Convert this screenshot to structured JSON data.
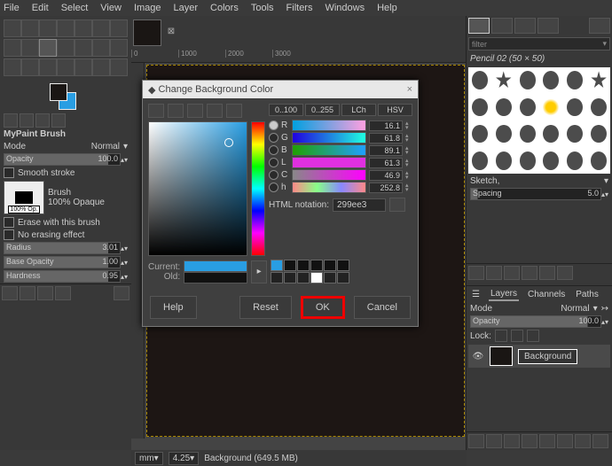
{
  "menu": [
    "File",
    "Edit",
    "Select",
    "View",
    "Image",
    "Layer",
    "Colors",
    "Tools",
    "Filters",
    "Windows",
    "Help"
  ],
  "toolbox": {
    "section_title": "MyPaint Brush",
    "mode_label": "Mode",
    "mode_value": "Normal",
    "opacity_label": "Opacity",
    "opacity_value": "100.0",
    "smooth_stroke": "Smooth stroke",
    "brush_label": "Brush",
    "brush_badge": "100% Op.",
    "brush_name": "100% Opaque",
    "erase_label": "Erase with this brush",
    "no_erase_label": "No erasing effect",
    "radius_label": "Radius",
    "radius_value": "3.01",
    "base_opacity_label": "Base Opacity",
    "base_opacity_value": "1.00",
    "hardness_label": "Hardness",
    "hardness_value": "0.95"
  },
  "ruler": {
    "0": "0",
    "1": "1000",
    "2": "2000",
    "3": "3000"
  },
  "statusbar": {
    "units": "mm",
    "zoom": "4.25",
    "layer": "Background (649.5 MB)"
  },
  "brushes": {
    "filter": "filter",
    "current": "Pencil 02 (50 × 50)",
    "category": "Sketch,",
    "spacing_label": "Spacing",
    "spacing_value": "5.0"
  },
  "layers": {
    "tabs": {
      "layers": "Layers",
      "channels": "Channels",
      "paths": "Paths"
    },
    "mode_label": "Mode",
    "mode_value": "Normal",
    "opacity_label": "Opacity",
    "opacity_value": "100.0",
    "lock_label": "Lock:",
    "layer_name": "Background"
  },
  "dialog": {
    "title": "Change Background Color",
    "range_a": "0..100",
    "range_b": "0..255",
    "model_a": "LCh",
    "model_b": "HSV",
    "channels": {
      "R": {
        "label": "R",
        "value": "16.1"
      },
      "G": {
        "label": "G",
        "value": "61.8"
      },
      "B": {
        "label": "B",
        "value": "89.1"
      },
      "L": {
        "label": "L",
        "value": "61.3"
      },
      "C": {
        "label": "C",
        "value": "46.9"
      },
      "h": {
        "label": "h",
        "value": "252.8"
      }
    },
    "html_label": "HTML notation:",
    "html_value": "299ee3",
    "current_label": "Current:",
    "old_label": "Old:",
    "btn_help": "Help",
    "btn_reset": "Reset",
    "btn_ok": "OK",
    "btn_cancel": "Cancel"
  }
}
